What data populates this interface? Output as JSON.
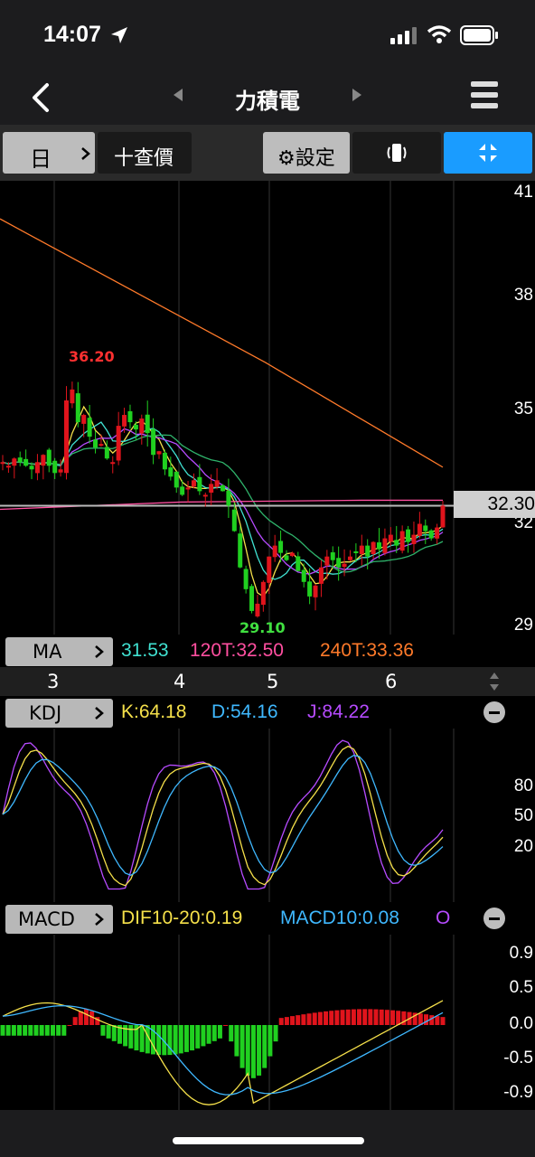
{
  "status_bar": {
    "time": "14:07"
  },
  "nav": {
    "title": "力積電"
  },
  "toolbar": {
    "period_label": "日",
    "add_price_label": "十查價",
    "settings_label": "⚙設定"
  },
  "price_axis": {
    "labels": [
      "41",
      "38",
      "35",
      "32",
      "29"
    ],
    "current_price": "32.30"
  },
  "annotations": {
    "high": "36.20",
    "low": "29.10"
  },
  "ma_bar": {
    "label": "MA",
    "ma_short": "31.53",
    "ma_120": "120T:32.50",
    "ma_240": "240T:33.36"
  },
  "months": [
    "3",
    "4",
    "5",
    "6"
  ],
  "kdj_bar": {
    "label": "KDJ",
    "k": "K:64.18",
    "d": "D:54.16",
    "j": "J:84.22"
  },
  "kdj_axis": [
    "80",
    "50",
    "20"
  ],
  "macd_bar": {
    "label": "MACD",
    "dif": "DIF10-20:0.19",
    "macd": "MACD10:0.08",
    "osc": "O"
  },
  "macd_axis": [
    "0.9",
    "0.5",
    "0.0",
    "-0.5",
    "-0.9"
  ],
  "colors": {
    "accent_blue": "#1a9cff",
    "up": "#e0141c",
    "down": "#20d020",
    "ma_short": "#40e0d0",
    "ma_120": "#ff4fa0",
    "ma_240": "#ff7a2a",
    "k": "#f5e04a",
    "d": "#3fb8ff",
    "j": "#b64bff"
  },
  "chart_data": [
    {
      "type": "candlestick",
      "series": [
        {
          "name": "MA",
          "values": [
            31.53
          ]
        },
        {
          "name": "120T",
          "values": [
            32.5
          ]
        },
        {
          "name": "240T",
          "values": [
            33.36
          ]
        }
      ],
      "x": [
        "3",
        "4",
        "5",
        "6"
      ],
      "ylim": [
        29,
        41
      ],
      "high": 36.2,
      "low": 29.1,
      "last": 32.3
    },
    {
      "type": "line",
      "series": [
        {
          "name": "K",
          "values": [
            64.18
          ]
        },
        {
          "name": "D",
          "values": [
            54.16
          ]
        },
        {
          "name": "J",
          "values": [
            84.22
          ]
        }
      ],
      "yticks": [
        80,
        50,
        20
      ]
    },
    {
      "type": "line",
      "series": [
        {
          "name": "DIF10-20",
          "values": [
            0.19
          ]
        },
        {
          "name": "MACD10",
          "values": [
            0.08
          ]
        }
      ],
      "yticks": [
        0.9,
        0.5,
        0.0,
        -0.5,
        -0.9
      ]
    }
  ]
}
